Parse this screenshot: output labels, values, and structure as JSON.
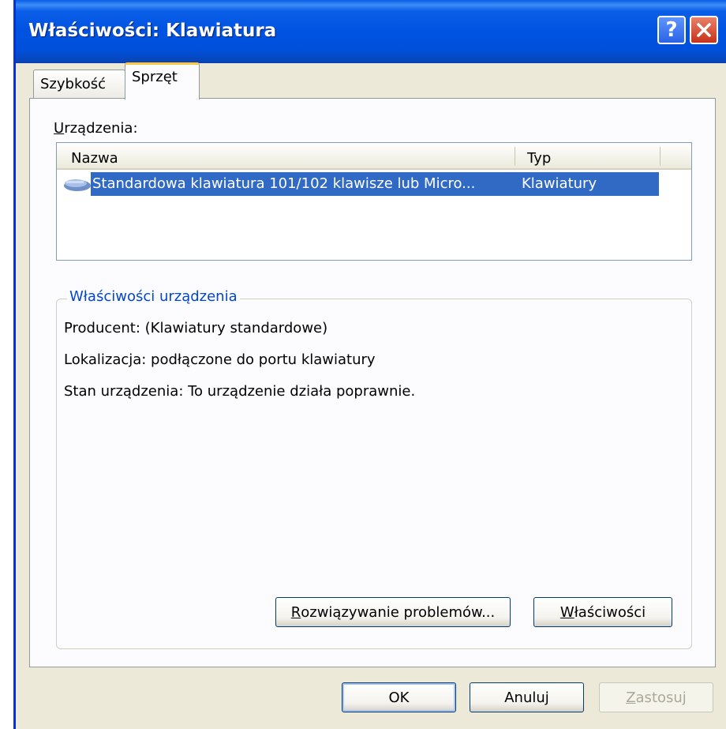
{
  "window": {
    "title": "Właściwości: Klawiatura",
    "help_label": "?",
    "close_label": "X"
  },
  "tabs": [
    {
      "label": "Szybkość",
      "active": false
    },
    {
      "label": "Sprzęt",
      "active": true
    }
  ],
  "devices": {
    "label_hotkey": "U",
    "label_rest": "rządzenia:",
    "columns": [
      "Nazwa",
      "Typ"
    ],
    "rows": [
      {
        "name": "Standardowa klawiatura 101/102 klawisze lub Micro...",
        "type": "Klawiatury",
        "selected": true,
        "icon": "keyboard-icon"
      }
    ]
  },
  "device_properties": {
    "title": "Właściwości urządzenia",
    "lines": [
      "Producent: (Klawiatury standardowe)",
      "Lokalizacja: podłączone do portu klawiatury",
      "Stan urządzenia: To urządzenie działa poprawnie."
    ],
    "troubleshoot_hotkey": "R",
    "troubleshoot_rest": "ozwiązywanie problemów...",
    "properties_hotkey": "W",
    "properties_rest": "łaściwości"
  },
  "buttons": {
    "ok": "OK",
    "cancel": "Anuluj",
    "apply_hotkey": "Z",
    "apply_rest": "astosuj",
    "apply_enabled": false
  },
  "colors": {
    "titlebar": "#0053e1",
    "selection": "#316ac5",
    "group_title": "#0046d5",
    "dialog_bg": "#ece9d8"
  }
}
